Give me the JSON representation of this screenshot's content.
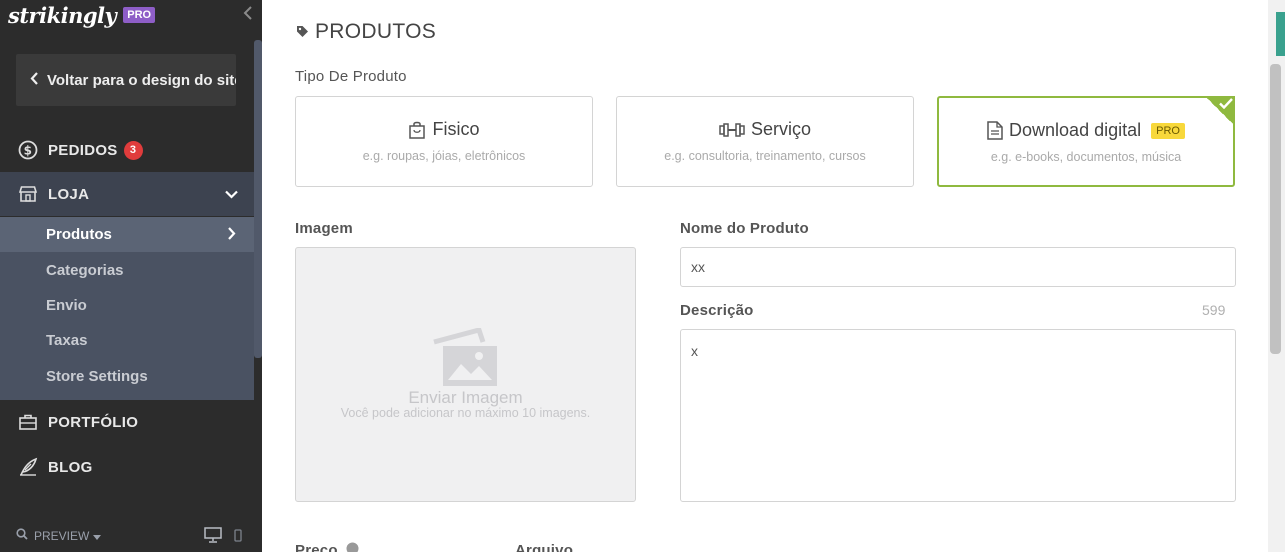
{
  "sidebar": {
    "logo": "strikingly",
    "pro_badge": "PRO",
    "back_label": "Voltar para o design do site",
    "nav": {
      "pedidos": "PEDIDOS",
      "pedidos_count": "3",
      "loja": "LOJA",
      "portfolio": "PORTFÓLIO",
      "blog": "BLOG"
    },
    "sub_items": [
      "Produtos",
      "Categorias",
      "Envio",
      "Taxas",
      "Store Settings"
    ],
    "preview": "PREVIEW"
  },
  "main": {
    "title": "PRODUTOS",
    "product_type_label": "Tipo De Produto",
    "types": [
      {
        "title": "Fisico",
        "hint": "e.g. roupas, jóias, eletrônicos"
      },
      {
        "title": "Serviço",
        "hint": "e.g. consultoria, treinamento, cursos"
      },
      {
        "title": "Download digital",
        "badge": "PRO",
        "hint": "e.g. e-books, documentos, música"
      }
    ],
    "image_label": "Imagem",
    "upload_text": "Enviar Imagem",
    "upload_hint": "Você pode adicionar no máximo 10 imagens.",
    "name_label": "Nome do Produto",
    "name_value": "xx",
    "description_label": "Descrição",
    "description_counter": "599",
    "description_value": "x",
    "price_label": "Preço",
    "file_label": "Arquivo"
  },
  "colors": {
    "sidebar_bg": "#2c2c2c",
    "selected_border": "#8fb93f",
    "pro_purple": "#8e5ec7",
    "pro_yellow": "#f8d83b",
    "badge_red": "#e03c3c"
  }
}
